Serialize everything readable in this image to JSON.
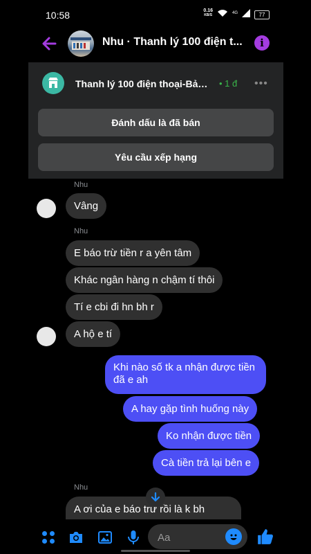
{
  "status_bar": {
    "time": "10:58",
    "net_speed_top": "0.16",
    "net_speed_bottom": "KB/S",
    "network_label": "4G",
    "battery": "77"
  },
  "header": {
    "title": "Nhu · Thanh lý 100 điện t..."
  },
  "listing": {
    "title": "Thanh lý 100 điện thoại-Bảo...",
    "price": "• 1 đ",
    "more": "•••",
    "mark_sold_label": "Đánh dấu là đã bán",
    "request_rating_label": "Yêu cầu xếp hạng"
  },
  "messages": [
    {
      "sender": "Nhu",
      "text": "Vâng"
    },
    {
      "sender": "Nhu",
      "text": "E báo trừ tiền r a yên tâm"
    },
    {
      "text": "Khác ngân hàng n chậm tí thôi"
    },
    {
      "text": "Tí e cbi đi hn bh r"
    },
    {
      "text": "A hộ e tí"
    },
    {
      "text": "Khi nào số tk a nhận được tiền đã e ah"
    },
    {
      "text": "A hay gặp tình huống này"
    },
    {
      "text": "Ko nhận được tiền"
    },
    {
      "text": "Cà tiền trả lại bên e"
    },
    {
      "sender": "Nhu",
      "text": "A ơi của e báo trừ rồi là k bh"
    }
  ],
  "composer": {
    "placeholder": "Aa"
  },
  "colors": {
    "accent": "#a43ce0",
    "outgoing": "#4d4ff5",
    "incoming": "#303030",
    "messenger_blue": "#1f8bff"
  }
}
